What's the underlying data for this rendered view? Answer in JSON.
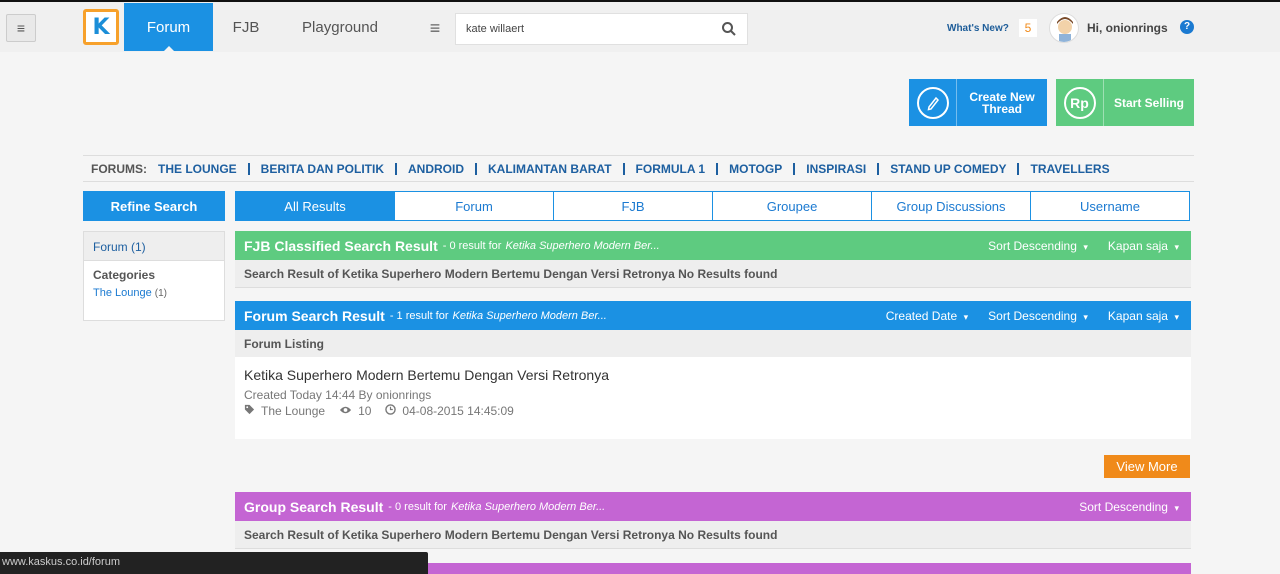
{
  "topbar": {
    "logo_letter": "K",
    "nav": [
      {
        "label": "Forum",
        "active": true
      },
      {
        "label": "FJB",
        "active": false
      },
      {
        "label": "Playground",
        "active": false
      }
    ],
    "search_value": "kate willaert",
    "whats_new_label": "What's New?",
    "notification_count": "5",
    "greeting": "Hi, onionrings",
    "help_glyph": "?"
  },
  "actions": {
    "create_thread_label": "Create New Thread",
    "start_selling_label": "Start Selling",
    "start_selling_icon_text": "Rp"
  },
  "forums_bar": {
    "label": "FORUMS:",
    "links": [
      "THE LOUNGE",
      "BERITA DAN POLITIK",
      "ANDROID",
      "KALIMANTAN BARAT",
      "FORMULA 1",
      "MOTOGP",
      "INSPIRASI",
      "STAND UP COMEDY",
      "TRAVELLERS"
    ]
  },
  "sidebar": {
    "refine_label": "Refine Search",
    "forum_count": "Forum (1)",
    "categories_title": "Categories",
    "category_item": "The Lounge",
    "category_count": "(1)"
  },
  "tabs": [
    "All Results",
    "Forum",
    "FJB",
    "Groupee",
    "Group Discussions",
    "Username"
  ],
  "fjb_section": {
    "title": "FJB Classified Search Result",
    "summary": "- 0 result for",
    "query": "Ketika Superhero Modern Ber...",
    "sort1": "Sort Descending",
    "sort2": "Kapan saja",
    "message": "Search Result of Ketika Superhero Modern Bertemu Dengan Versi Retronya No Results found",
    "color": "#5ecb80"
  },
  "forum_section": {
    "title": "Forum Search Result",
    "summary": "- 1 result for",
    "query": "Ketika Superhero Modern Ber...",
    "sort0": "Created Date",
    "sort1": "Sort Descending",
    "sort2": "Kapan saja",
    "listing_label": "Forum Listing",
    "color": "#1b91e3",
    "result": {
      "title": "Ketika Superhero Modern Bertemu Dengan Versi Retronya",
      "meta": "Created Today 14:44 By onionrings",
      "category": "The Lounge",
      "views": "10",
      "timestamp": "04-08-2015 14:45:09"
    },
    "view_more_label": "View More"
  },
  "group_section": {
    "title": "Group Search Result",
    "summary": "- 0 result for",
    "query": "Ketika Superhero Modern Ber...",
    "sort1": "Sort Descending",
    "message": "Search Result of Ketika Superhero Modern Bertemu Dengan Versi Retronya No Results found",
    "color": "#c465d3"
  },
  "status_bar": {
    "url": "www.kaskus.co.id/forum"
  }
}
